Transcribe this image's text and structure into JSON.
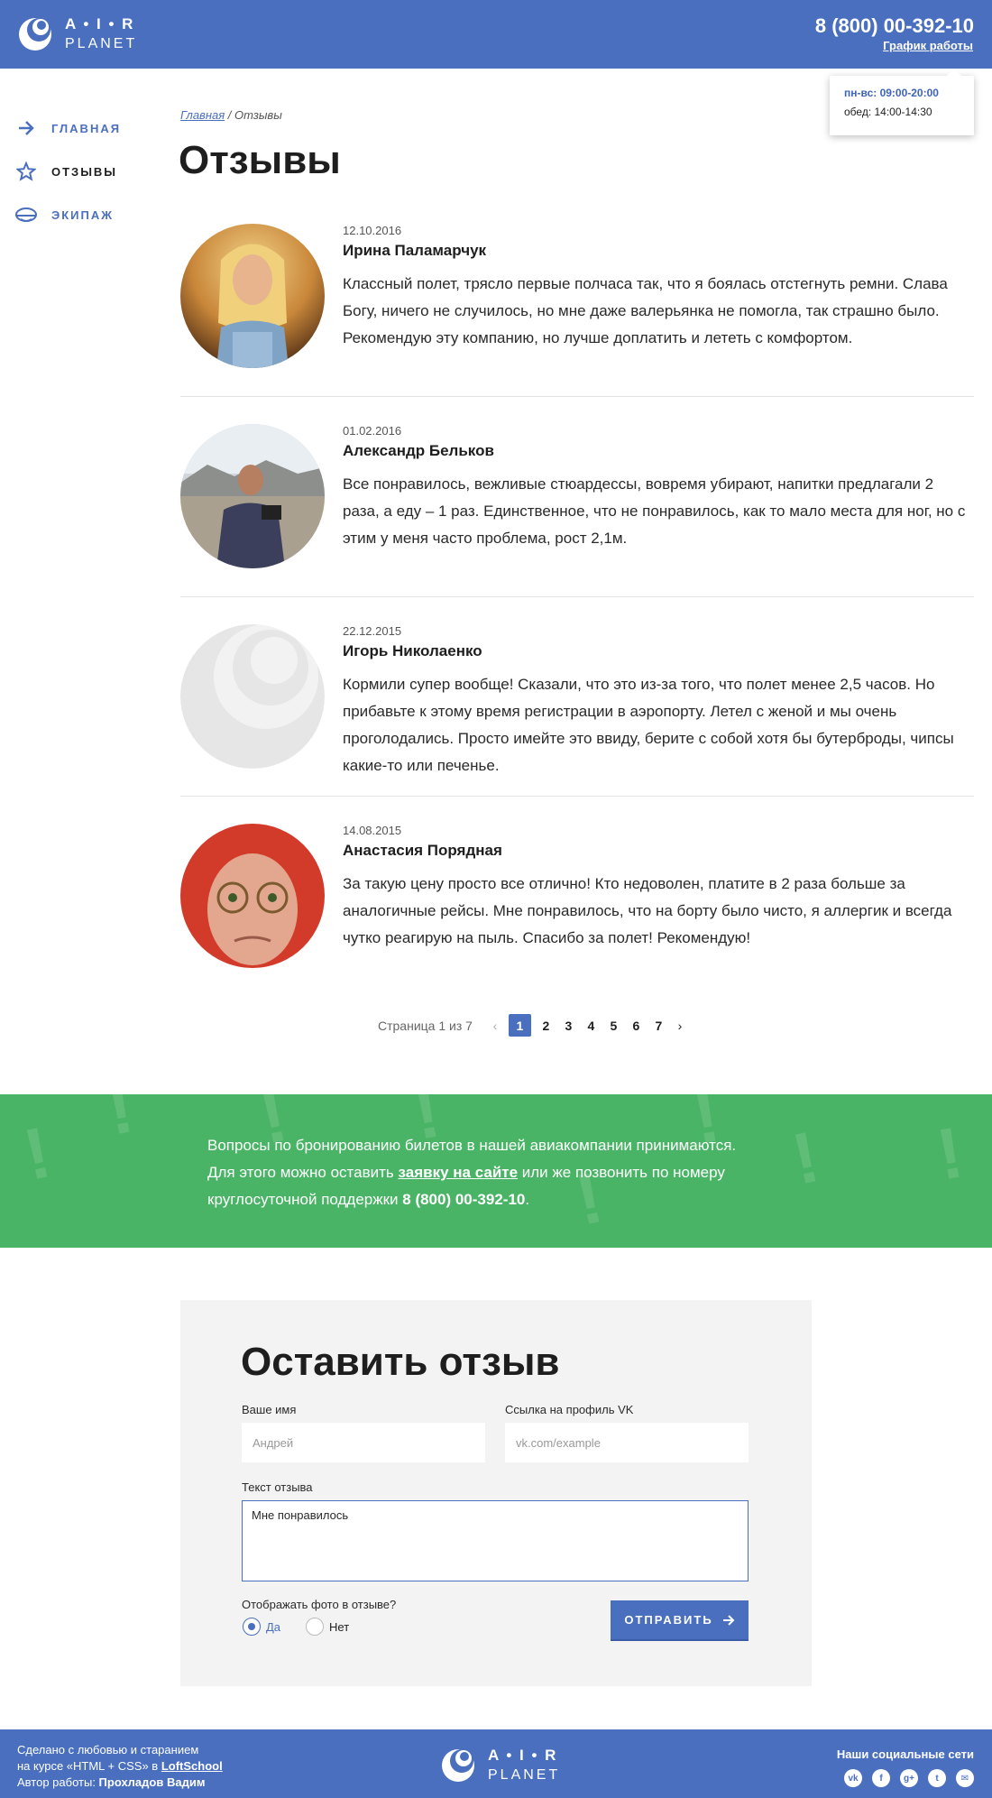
{
  "header": {
    "logo_line1": "A • I • R",
    "logo_line2": "PLANET",
    "phone": "8 (800) 00-392-10",
    "schedule_link": "График работы",
    "tooltip": {
      "hours": "пн-вс: 09:00-20:00",
      "lunch": "обед: 14:00-14:30"
    }
  },
  "sidebar": {
    "items": [
      {
        "label": "ГЛАВНАЯ",
        "icon": "arrow-right-icon"
      },
      {
        "label": "ОТЗЫВЫ",
        "icon": "star-icon",
        "active": true
      },
      {
        "label": "ЭКИПАЖ",
        "icon": "pilot-cap-icon"
      }
    ]
  },
  "breadcrumb": {
    "home": "Главная",
    "separator": " / ",
    "current": "Отзывы"
  },
  "page_title": "Отзывы",
  "reviews": [
    {
      "date": "12.10.2016",
      "name": "Ирина Паламарчук",
      "text": "Классный полет, трясло первые полчаса так, что я боялась отстегнуть ремни. Слава Богу, ничего не случилось, но мне даже валерьянка не помогла, так страшно было. Рекомендую эту компанию, но лучше доплатить и лететь с комфортом."
    },
    {
      "date": "01.02.2016",
      "name": "Александр Бельков",
      "text": "Все понравилось, вежливые стюардессы, вовремя убирают, напитки предлагали 2 раза, а еду – 1 раз. Единственное, что не понравилось, как то мало места для ног, но с этим у меня часто проблема, рост 2,1м."
    },
    {
      "date": "22.12.2015",
      "name": "Игорь Николаенко",
      "text": "Кормили супер вообще! Сказали, что это из-за того, что полет менее 2,5 часов. Но прибавьте к этому время регистрации в аэропорту. Летел с женой и мы очень проголодались. Просто имейте это ввиду, берите с собой хотя бы бутерброды, чипсы какие-то или печенье."
    },
    {
      "date": "14.08.2015",
      "name": "Анастасия Порядная",
      "text": "За такую цену просто все отлично! Кто недоволен, платите в 2 раза больше за аналогичные рейсы. Мне понравилось, что на борту было чисто, я аллергик и всегда чутко реагирую на пыль. Спасибо за полет! Рекомендую!"
    }
  ],
  "pagination": {
    "info": "Страница 1 из 7",
    "prev": "‹",
    "next": "›",
    "pages": [
      "1",
      "2",
      "3",
      "4",
      "5",
      "6",
      "7"
    ],
    "current": "1"
  },
  "info_band": {
    "line1": "Вопросы по бронированию билетов в нашей авиакомпании принимаются.",
    "line2_pre": "Для этого можно оставить ",
    "link": "заявку на сайте",
    "line2_post": " или же позвонить по номеру",
    "line3_pre": "круглосуточной поддержки ",
    "phone": "8 (800) 00-392-10",
    "line3_post": "."
  },
  "form": {
    "title": "Оставить отзыв",
    "name_label": "Ваше имя",
    "name_placeholder": "Андрей",
    "vk_label": "Ссылка на профиль VK",
    "vk_placeholder": "vk.com/example",
    "text_label": "Текст отзыва",
    "text_value": "Мне понравилось",
    "photo_question": "Отображать фото в отзыве?",
    "yes": "Да",
    "no": "Нет",
    "submit": "ОТПРАВИТЬ"
  },
  "footer": {
    "line1": "Сделано с любовью и старанием",
    "line2_pre": "на курсе «HTML + CSS» в ",
    "line2_link": "LoftSchool",
    "line3_pre": "Автор работы: ",
    "author": "Прохладов Вадим",
    "social_title": "Наши социальные сети",
    "socials": [
      "vk-icon",
      "facebook-icon",
      "google-plus-icon",
      "twitter-icon",
      "mail-icon"
    ]
  },
  "colors": {
    "primary": "#4a6fbf",
    "green": "#4ab466",
    "form_bg": "#f3f3f3"
  }
}
